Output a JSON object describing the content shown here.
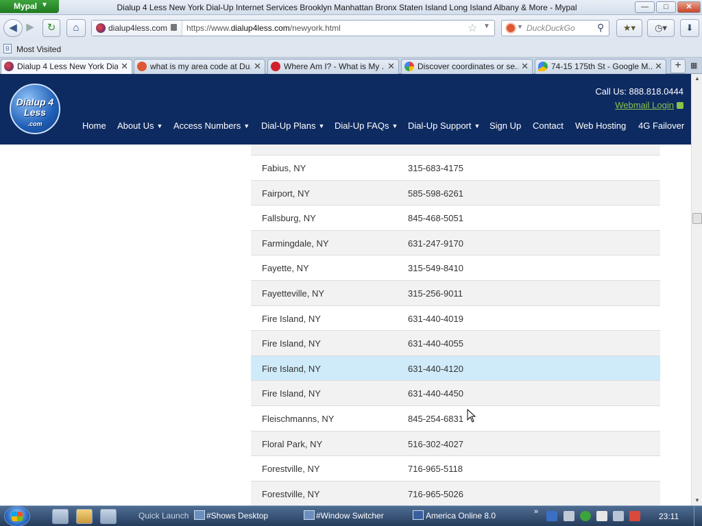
{
  "window": {
    "app_button": "Mypal",
    "title": "Dialup 4 Less New York Dial-Up Internet Services Brooklyn Manhattan Bronx Staten Island Long Island Albany & More - Mypal",
    "min": "—",
    "max": "□",
    "close": "✕"
  },
  "navbar": {
    "site_identity": "dialup4less.com",
    "url_prefix": "https://www.",
    "url_domain": "dialup4less.com",
    "url_path": "/newyork.html",
    "search_placeholder": "DuckDuckGo"
  },
  "bookmarks_bar": {
    "most_visited": "Most Visited"
  },
  "tabs": [
    {
      "label": "Dialup 4 Less New York Dia...",
      "active": true,
      "fav_color": "#3a2a7a"
    },
    {
      "label": "what is my area code at Du...",
      "active": false,
      "fav_color": "#de5833"
    },
    {
      "label": "Where Am I? - What is My ...",
      "active": false,
      "fav_color": "#d21f2c"
    },
    {
      "label": "Discover coordinates or se...",
      "active": false,
      "fav_color": "#4285f4"
    },
    {
      "label": "74-15 175th St - Google M...",
      "active": false,
      "fav_color": "#34a853"
    }
  ],
  "site": {
    "logo_text": "Dialup 4 Less",
    "logo_tld": ".com",
    "call_us": "Call Us: 888.818.0444",
    "webmail": "Webmail Login",
    "nav": [
      {
        "label": "Home",
        "dropdown": false
      },
      {
        "label": "About Us",
        "dropdown": true
      },
      {
        "label": "Access Numbers",
        "dropdown": true
      },
      {
        "label": "Dial-Up Plans",
        "dropdown": true
      },
      {
        "label": "Dial-Up FAQs",
        "dropdown": true
      },
      {
        "label": "Dial-Up Support",
        "dropdown": true
      },
      {
        "label": "Sign Up",
        "dropdown": false
      },
      {
        "label": "Contact",
        "dropdown": false
      },
      {
        "label": "Web Hosting",
        "dropdown": false
      },
      {
        "label": "4G Failover",
        "dropdown": false
      }
    ]
  },
  "access_numbers": [
    {
      "city": "Fabius, NY",
      "phone": "315-683-4175"
    },
    {
      "city": "Fairport, NY",
      "phone": "585-598-6261"
    },
    {
      "city": "Fallsburg, NY",
      "phone": "845-468-5051"
    },
    {
      "city": "Farmingdale, NY",
      "phone": "631-247-9170"
    },
    {
      "city": "Fayette, NY",
      "phone": "315-549-8410"
    },
    {
      "city": "Fayetteville, NY",
      "phone": "315-256-9011"
    },
    {
      "city": "Fire Island, NY",
      "phone": "631-440-4019"
    },
    {
      "city": "Fire Island, NY",
      "phone": "631-440-4055"
    },
    {
      "city": "Fire Island, NY",
      "phone": "631-440-4120",
      "hovered": true
    },
    {
      "city": "Fire Island, NY",
      "phone": "631-440-4450"
    },
    {
      "city": "Fleischmanns, NY",
      "phone": "845-254-6831"
    },
    {
      "city": "Floral Park, NY",
      "phone": "516-302-4027"
    },
    {
      "city": "Forestville, NY",
      "phone": "716-965-5118"
    },
    {
      "city": "Forestville, NY",
      "phone": "716-965-5026"
    }
  ],
  "taskbar": {
    "quick_launch": "Quick Launch",
    "shows_desktop": "#Shows Desktop",
    "window_switcher": "#Window Switcher",
    "aol": "America Online 8.0",
    "clock": "23:11"
  }
}
